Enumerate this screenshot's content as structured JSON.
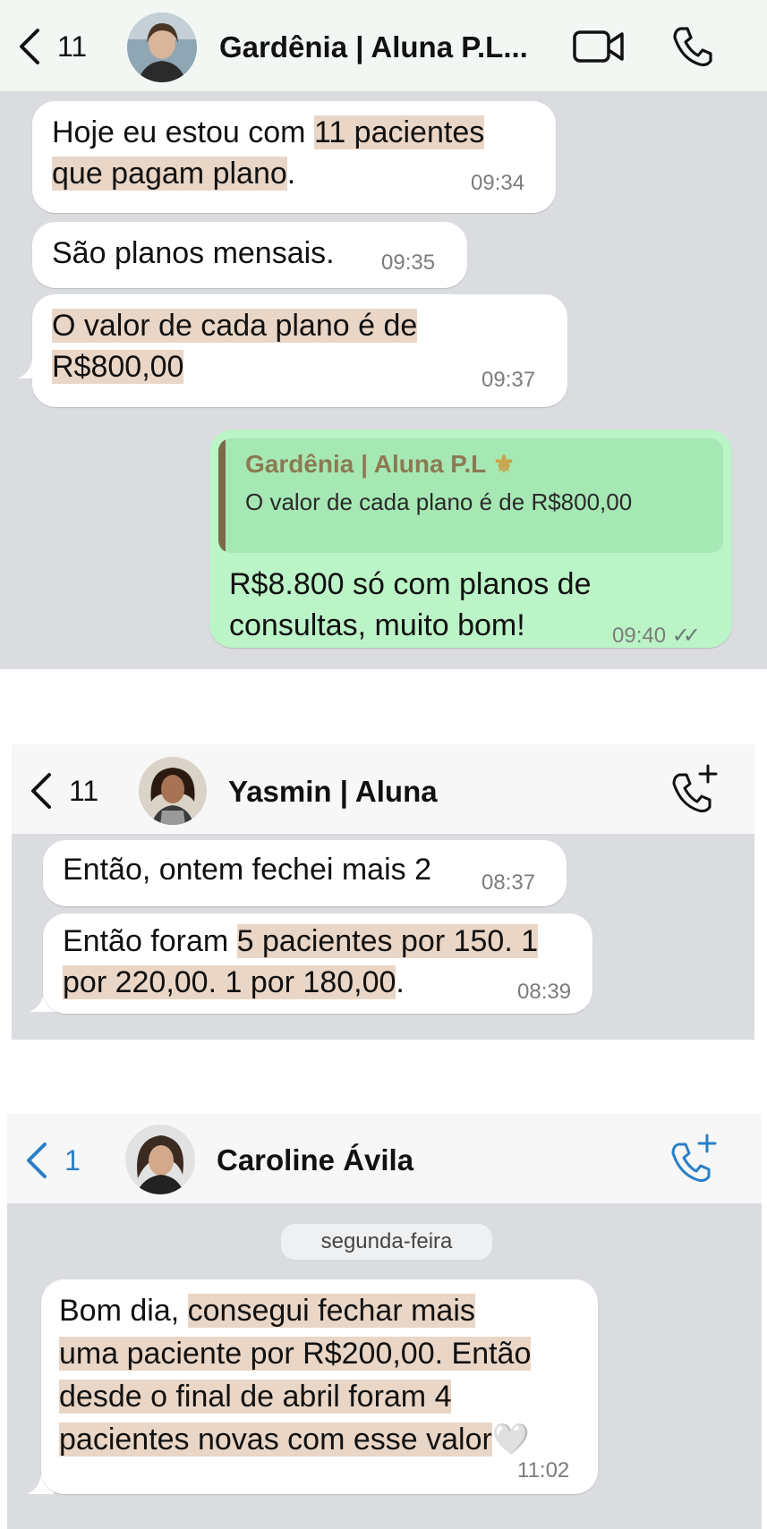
{
  "chats": [
    {
      "back_count": "11",
      "contact_name": "Gardênia | Aluna P.L...",
      "icons": [
        "chevron-left-icon",
        "avatar-photo",
        "video-call-icon",
        "phone-icon"
      ],
      "messages": [
        {
          "parts": [
            "Hoje eu estou com ",
            "11 pacientes",
            "que pagam plano",
            "."
          ],
          "time": "09:34"
        },
        {
          "text": "São planos mensais.",
          "time": "09:35"
        },
        {
          "parts": [
            "O valor de cada plano é de",
            "R$800,00"
          ],
          "time": "09:37"
        }
      ],
      "reply": {
        "quote_author": "Gardênia | Aluna P.L",
        "quote_emoji": "⚜",
        "quote_text": "O valor de cada plano é de R$800,00",
        "lines": [
          "R$8.800 só com planos de",
          "consultas, muito bom!"
        ],
        "time": "09:40",
        "status": "✓✓"
      }
    },
    {
      "back_count": "11",
      "contact_name": "Yasmin | Aluna",
      "icons": [
        "chevron-left-icon",
        "avatar-photo",
        "add-call-icon"
      ],
      "messages": [
        {
          "text": "Então, ontem fechei mais 2",
          "time": "08:37"
        },
        {
          "parts": [
            "Então foram ",
            "5 pacientes por 150. 1",
            "por 220,00. 1 por 180,00",
            "."
          ],
          "time": "08:39"
        }
      ]
    },
    {
      "back_count": "1",
      "contact_name": "Caroline Ávila",
      "icons": [
        "chevron-left-icon",
        "avatar-photo",
        "add-call-icon"
      ],
      "date_label": "segunda-feira",
      "messages": [
        {
          "parts": [
            "Bom dia, ",
            "consegui fechar mais",
            "uma paciente por R$200,00. Então",
            "desde o final de abril foram 4",
            "pacientes novas com esse valor",
            "🤍"
          ],
          "time": "11:02"
        }
      ]
    }
  ],
  "colors": {
    "accent_blue": "#2a7fc7",
    "highlight": "#ead6c6",
    "outgoing_bubble": "#bbf4c6",
    "chat_background": "#dadce0"
  }
}
